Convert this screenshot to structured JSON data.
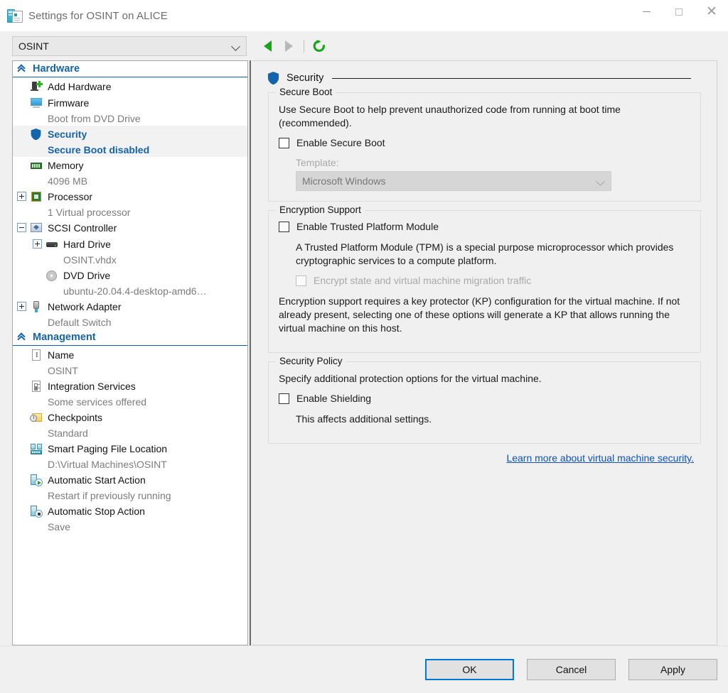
{
  "window": {
    "title": "Settings for OSINT on ALICE",
    "icon": "hyperv-settings-icon",
    "controls": {
      "minimize": "minimize-icon",
      "maximize": "maximize-icon",
      "close": "close-icon"
    }
  },
  "toolbar": {
    "vm_selected": "OSINT",
    "back": "back-arrow-icon",
    "forward": "forward-arrow-icon",
    "refresh": "refresh-icon"
  },
  "sidebar": {
    "sections": [
      {
        "title": "Hardware",
        "items": [
          {
            "label": "Add Hardware",
            "sub": "",
            "icon": "add-hardware-icon",
            "expander": "none",
            "indent": 0,
            "selected": false
          },
          {
            "label": "Firmware",
            "sub": "Boot from DVD Drive",
            "icon": "firmware-icon",
            "expander": "none",
            "indent": 0,
            "selected": false
          },
          {
            "label": "Security",
            "sub": "Secure Boot disabled",
            "icon": "shield-icon",
            "expander": "none",
            "indent": 0,
            "selected": true
          },
          {
            "label": "Memory",
            "sub": "4096 MB",
            "icon": "memory-icon",
            "expander": "none",
            "indent": 0,
            "selected": false
          },
          {
            "label": "Processor",
            "sub": "1 Virtual processor",
            "icon": "processor-icon",
            "expander": "plus",
            "indent": 0,
            "selected": false
          },
          {
            "label": "SCSI Controller",
            "sub": "",
            "icon": "scsi-controller-icon",
            "expander": "minus",
            "indent": 0,
            "selected": false
          },
          {
            "label": "Hard Drive",
            "sub": "OSINT.vhdx",
            "icon": "hard-drive-icon",
            "expander": "plus",
            "indent": 1,
            "selected": false
          },
          {
            "label": "DVD Drive",
            "sub": "ubuntu-20.04.4-desktop-amd6…",
            "icon": "dvd-drive-icon",
            "expander": "none",
            "indent": 1,
            "selected": false
          },
          {
            "label": "Network Adapter",
            "sub": "Default Switch",
            "icon": "network-adapter-icon",
            "expander": "plus",
            "indent": 0,
            "selected": false
          }
        ]
      },
      {
        "title": "Management",
        "items": [
          {
            "label": "Name",
            "sub": "OSINT",
            "icon": "name-icon",
            "expander": "none",
            "indent": 0,
            "selected": false
          },
          {
            "label": "Integration Services",
            "sub": "Some services offered",
            "icon": "integration-services-icon",
            "expander": "none",
            "indent": 0,
            "selected": false
          },
          {
            "label": "Checkpoints",
            "sub": "Standard",
            "icon": "checkpoints-icon",
            "expander": "none",
            "indent": 0,
            "selected": false
          },
          {
            "label": "Smart Paging File Location",
            "sub": "D:\\Virtual Machines\\OSINT",
            "icon": "smart-paging-icon",
            "expander": "none",
            "indent": 0,
            "selected": false
          },
          {
            "label": "Automatic Start Action",
            "sub": "Restart if previously running",
            "icon": "auto-start-icon",
            "expander": "none",
            "indent": 0,
            "selected": false
          },
          {
            "label": "Automatic Stop Action",
            "sub": "Save",
            "icon": "auto-stop-icon",
            "expander": "none",
            "indent": 0,
            "selected": false
          }
        ]
      }
    ]
  },
  "main": {
    "header": "Security",
    "header_icon": "shield-icon",
    "secure_boot": {
      "legend": "Secure Boot",
      "description": "Use Secure Boot to help prevent unauthorized code from running at boot time (recommended).",
      "enable_label": "Enable Secure Boot",
      "enable_checked": false,
      "template_label": "Template:",
      "template_value": "Microsoft Windows",
      "template_disabled": true
    },
    "encryption_support": {
      "legend": "Encryption Support",
      "tpm_label": "Enable Trusted Platform Module",
      "tpm_checked": false,
      "tpm_description": "A Trusted Platform Module (TPM) is a special purpose microprocessor which provides cryptographic services to a compute platform.",
      "migration_label": "Encrypt state and virtual machine migration traffic",
      "migration_checked": false,
      "migration_disabled": true,
      "note": "Encryption support requires a key protector (KP) configuration for the virtual machine. If not already present, selecting one of these options will generate a KP that allows running the virtual machine on this host."
    },
    "security_policy": {
      "legend": "Security Policy",
      "description": "Specify additional protection options for the virtual machine.",
      "shielding_label": "Enable Shielding",
      "shielding_checked": false,
      "shielding_note": "This affects additional settings."
    },
    "learn_more_link": "Learn more about virtual machine security."
  },
  "footer": {
    "ok": "OK",
    "cancel": "Cancel",
    "apply": "Apply"
  },
  "colors": {
    "accent_blue": "#1464ad",
    "link_blue": "#0b51c5",
    "focus_blue": "#0078d7",
    "green": "#17a81a"
  }
}
